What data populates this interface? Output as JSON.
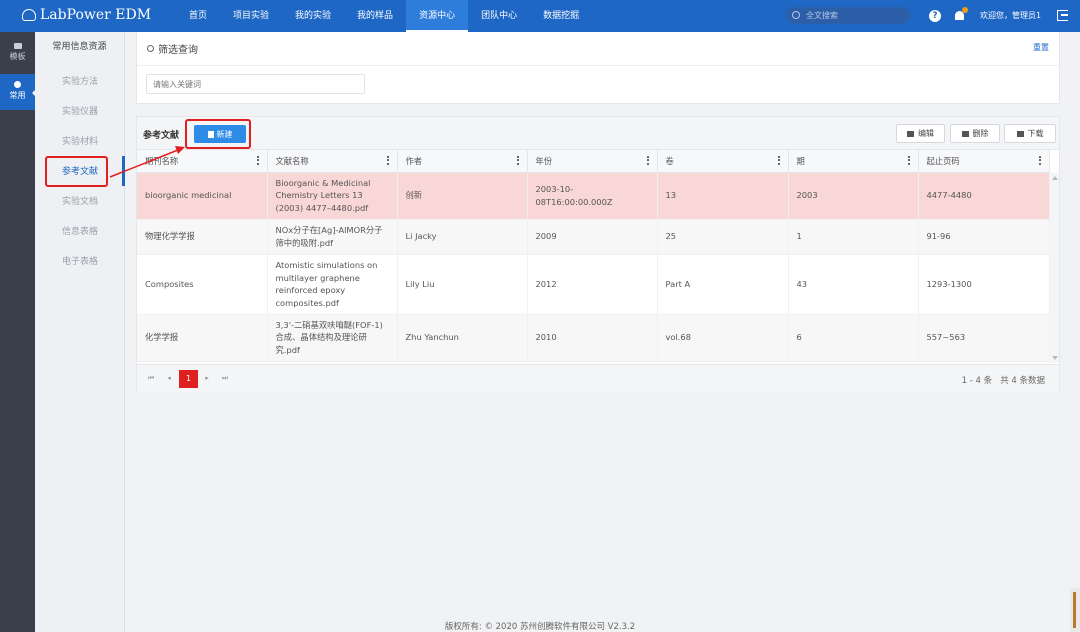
{
  "app": {
    "logo_text": "LabPower EDM"
  },
  "nav": [
    {
      "label": "首页",
      "active": false
    },
    {
      "label": "项目实验",
      "active": false
    },
    {
      "label": "我的实验",
      "active": false
    },
    {
      "label": "我的样品",
      "active": false
    },
    {
      "label": "资源中心",
      "active": true
    },
    {
      "label": "团队中心",
      "active": false
    },
    {
      "label": "数据挖掘",
      "active": false
    }
  ],
  "header": {
    "search_placeholder": "全文搜索",
    "help": "?",
    "welcome": "欢迎您，管理员1"
  },
  "rail": [
    {
      "label": "模板",
      "active": false
    },
    {
      "label": "常用",
      "active": true
    }
  ],
  "sidebar": {
    "title": "常用信息资源",
    "items": [
      {
        "label": "实验方法",
        "active": false
      },
      {
        "label": "实验仪器",
        "active": false
      },
      {
        "label": "实验材料",
        "active": false
      },
      {
        "label": "参考文献",
        "active": true
      },
      {
        "label": "实验文档",
        "active": false
      },
      {
        "label": "信息表格",
        "active": false
      },
      {
        "label": "电子表格",
        "active": false
      }
    ]
  },
  "filter": {
    "title": "筛选查询",
    "reset": "重置",
    "keyword_placeholder": "请输入关键词"
  },
  "panel": {
    "title": "参考文献",
    "new_label": "新建",
    "edit_label": "编辑",
    "delete_label": "删除",
    "download_label": "下载"
  },
  "table": {
    "columns": [
      "期刊名称",
      "文献名称",
      "作者",
      "年份",
      "卷",
      "期",
      "起止页码"
    ],
    "rows": [
      [
        "bioorganic medicinal",
        "Bioorganic & Medicinal Chemistry Letters 13 (2003) 4477–4480.pdf",
        "创新",
        "2003-10-08T16:00:00.000Z",
        "13",
        "2003",
        "4477-4480"
      ],
      [
        "物理化学学报",
        "NOx分子在[Ag]-AlMOR分子筛中的吸附.pdf",
        "Li Jacky",
        "2009",
        "25",
        "1",
        "91-96"
      ],
      [
        "Composites",
        "Atomistic simulations on multilayer graphene reinforced epoxy composites.pdf",
        "Lily Liu",
        "2012",
        "Part A",
        "43",
        "1293-1300"
      ],
      [
        "化学学报",
        "3,3'-二硝基双呋咱醚(FOF-1)合成、晶体结构及理论研究.pdf",
        "Zhu Yanchun",
        "2010",
        "vol.68",
        "6",
        "557~563"
      ]
    ],
    "selected_row": 0
  },
  "pagination": {
    "current": "1",
    "range": "1 - 4 条",
    "total": "共 4 条数据"
  },
  "footer": "版权所有: © 2020 苏州创腾软件有限公司   V2.3.2"
}
